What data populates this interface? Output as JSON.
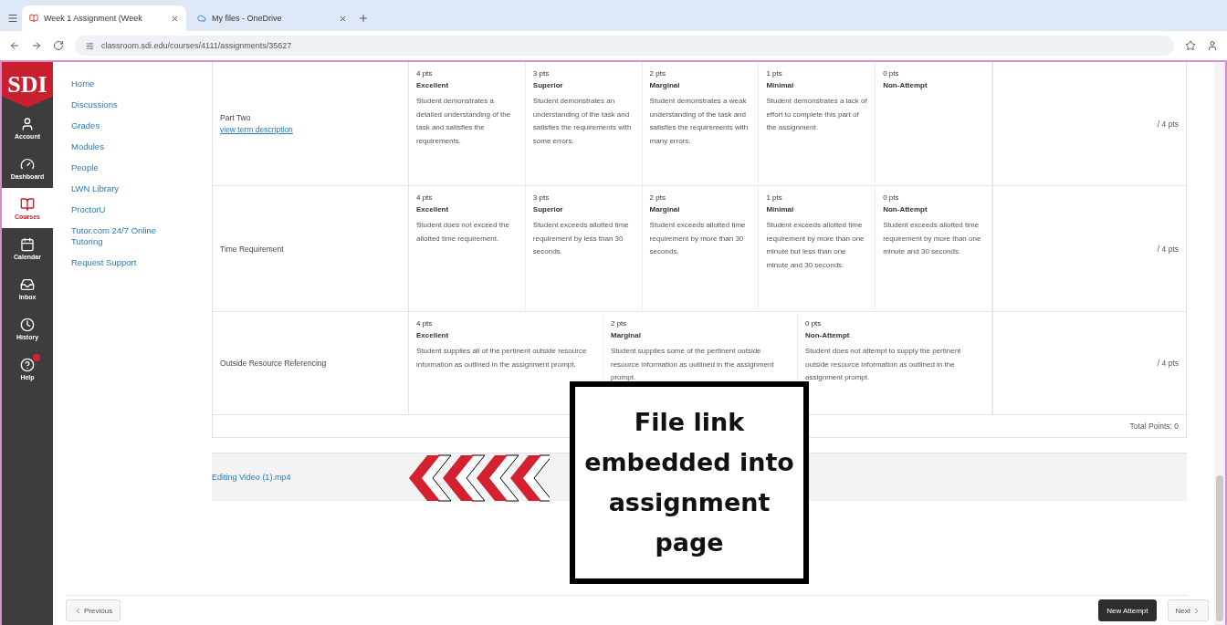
{
  "browser": {
    "tabs": [
      {
        "title": "Week 1 Assignment (Week",
        "selected": true
      },
      {
        "title": "My files - OneDrive",
        "selected": false
      }
    ],
    "url": "classroom.sdi.edu/courses/4111/assignments/35627"
  },
  "global_nav": {
    "logo": "SDI",
    "items": [
      {
        "label": "Account",
        "selected": false
      },
      {
        "label": "Dashboard",
        "selected": false
      },
      {
        "label": "Courses",
        "selected": true
      },
      {
        "label": "Calendar",
        "selected": false
      },
      {
        "label": "Inbox",
        "selected": false
      },
      {
        "label": "History",
        "selected": false
      },
      {
        "label": "Help",
        "selected": false
      }
    ]
  },
  "course_nav": [
    "Home",
    "Discussions",
    "Grades",
    "Modules",
    "People",
    "LWN Library",
    "ProctorU",
    "Tutor.com 24/7 Online Tutoring",
    "Request Support"
  ],
  "rubric": {
    "rows": [
      {
        "criterion": "Part Two",
        "link": "view term description",
        "score": "/ 4 pts",
        "ratings": [
          {
            "points": "4 pts",
            "title": "Excellent",
            "description": "Student demonstrates a detailed understanding of the task and satisfies the requirements."
          },
          {
            "points": "3 pts",
            "title": "Superior",
            "description": "Student demonstrates an understanding of the task and satisfies the requirements with some errors."
          },
          {
            "points": "2 pts",
            "title": "Marginal",
            "description": "Student demonstrates a weak understanding of the task and satisfies the requirements with many errors."
          },
          {
            "points": "1 pts",
            "title": "Minimal",
            "description": "Student demonstrates a lack of effort to complete this part of the assignment."
          },
          {
            "points": "0 pts",
            "title": "Non-Attempt"
          }
        ]
      },
      {
        "criterion": "Time Requirement",
        "score": "/ 4 pts",
        "ratings": [
          {
            "points": "4 pts",
            "title": "Excellent",
            "description": "Student does not exceed the allotted time requirement."
          },
          {
            "points": "3 pts",
            "title": "Superior",
            "description": "Student exceeds allotted time requirement by less than 30 seconds."
          },
          {
            "points": "2 pts",
            "title": "Marginal",
            "description": "Student exceeds allotted time requirement by more than 30 seconds."
          },
          {
            "points": "1 pts",
            "title": "Minimal",
            "description": "Student exceeds allotted time requirement by more than one minute but less than one minute and 30 seconds."
          },
          {
            "points": "0 pts",
            "title": "Non-Attempt",
            "description": "Student exceeds allotted time requirement by more than one minute and 30 seconds."
          }
        ]
      },
      {
        "criterion": "Outside Resource Referencing",
        "score": "/ 4 pts",
        "ratings": [
          {
            "points": "4 pts",
            "title": "Excellent",
            "description": "Student supplies all of the pertinent outside resource information as outlined in the assignment prompt."
          },
          {
            "points": "2 pts",
            "title": "Marginal",
            "description": "Student supplies some of the pertinent outside resource information as outlined in the assignment prompt."
          },
          {
            "points": "0 pts",
            "title": "Non-Attempt",
            "description": "Student does not attempt to supply the pertinent outside resource information as outlined in the assignment prompt."
          }
        ]
      }
    ],
    "total": "Total Points: 0"
  },
  "attachment": "Editing Video (1).mp4",
  "callout": "File link embedded into assignment page",
  "footer": {
    "previous": "Previous",
    "new_attempt": "New Attempt",
    "next": "Next"
  }
}
